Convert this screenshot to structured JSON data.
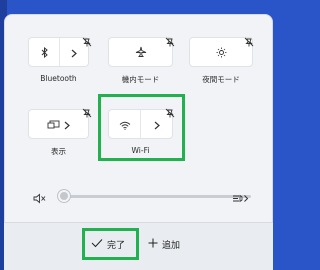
{
  "tiles": {
    "bluetooth": {
      "label": "Bluetooth",
      "icon": "bluetooth-icon"
    },
    "airplane": {
      "label": "機内モード",
      "icon": "airplane-icon"
    },
    "night_light": {
      "label": "夜間モード",
      "icon": "night-light-icon"
    },
    "display": {
      "label": "表示",
      "icon": "display-icon"
    },
    "wifi": {
      "label": "Wi-Fi",
      "icon": "wifi-icon"
    }
  },
  "volume": {
    "muted_icon": "volume-muted-icon",
    "output_icon": "audio-output-icon",
    "level": 0
  },
  "footer": {
    "done_label": "完了",
    "add_label": "追加"
  },
  "colors": {
    "desktop": "#2a55c8",
    "panel": "#f1f3f6",
    "highlight": "#21b24f"
  }
}
